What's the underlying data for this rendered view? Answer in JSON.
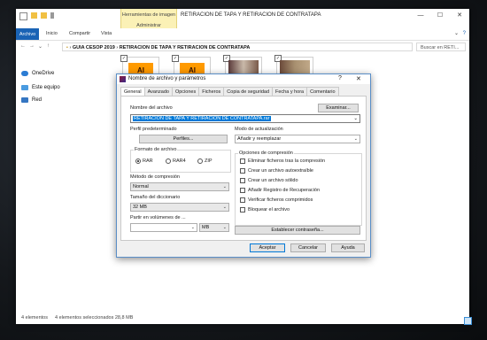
{
  "explorer": {
    "context_tab": "Herramientas de imagen",
    "context_sub": "Administrar",
    "window_title": "RETIRACION DE TAPA Y RETIRACION DE CONTRATAPA",
    "ribbon_tabs": [
      "Archivo",
      "Inicio",
      "Compartir",
      "Vista"
    ],
    "address_parts": [
      "GUIA CESOP 2019",
      "RETIRACION DE TAPA Y RETIRACION DE CONTRATAPA"
    ],
    "search_placeholder": "Buscar en RETI...",
    "nav_items": [
      "OneDrive",
      "Este equipo",
      "Red"
    ],
    "thumb_labels": [
      "AI",
      "AI"
    ],
    "status_items": "4 elementos",
    "status_selected": "4 elementos seleccionados  28,8 MB"
  },
  "dialog": {
    "title": "Nombre de archivo y parámetros",
    "help_glyph": "?",
    "close_glyph": "✕",
    "tabs": [
      "General",
      "Avanzado",
      "Opciones",
      "Ficheros",
      "Copia de seguridad",
      "Fecha y hora",
      "Comentario"
    ],
    "archive_name_label": "Nombre del archivo",
    "browse_button": "Examinar...",
    "archive_name_value": "RETIRACION DE TAPA Y RETIRACION DE CONTRATAPA.rar",
    "profile_label": "Perfil predeterminado",
    "profiles_button": "Perfiles...",
    "update_mode_label": "Modo de actualización",
    "update_mode_value": "Añadir y reemplazar",
    "format_label": "Formato de archivo",
    "formats": [
      "RAR",
      "RAR4",
      "ZIP"
    ],
    "format_selected": "RAR",
    "method_label": "Método de compresión",
    "method_value": "Normal",
    "dict_label": "Tamaño del diccionario",
    "dict_value": "32 MB",
    "split_label": "Partir en volúmenes de ...",
    "split_value": "",
    "split_unit": "MB",
    "options_label": "Opciones de compresión",
    "options": [
      "Eliminar ficheros tras la compresión",
      "Crear un archivo autoextraíble",
      "Crear un archivo sólido",
      "Añadir Registro de Recuperación",
      "Verificar ficheros comprimidos",
      "Bloquear el archivo"
    ],
    "password_button": "Establecer contraseña...",
    "ok_button": "Aceptar",
    "cancel_button": "Cancelar",
    "help_button": "Ayuda"
  }
}
